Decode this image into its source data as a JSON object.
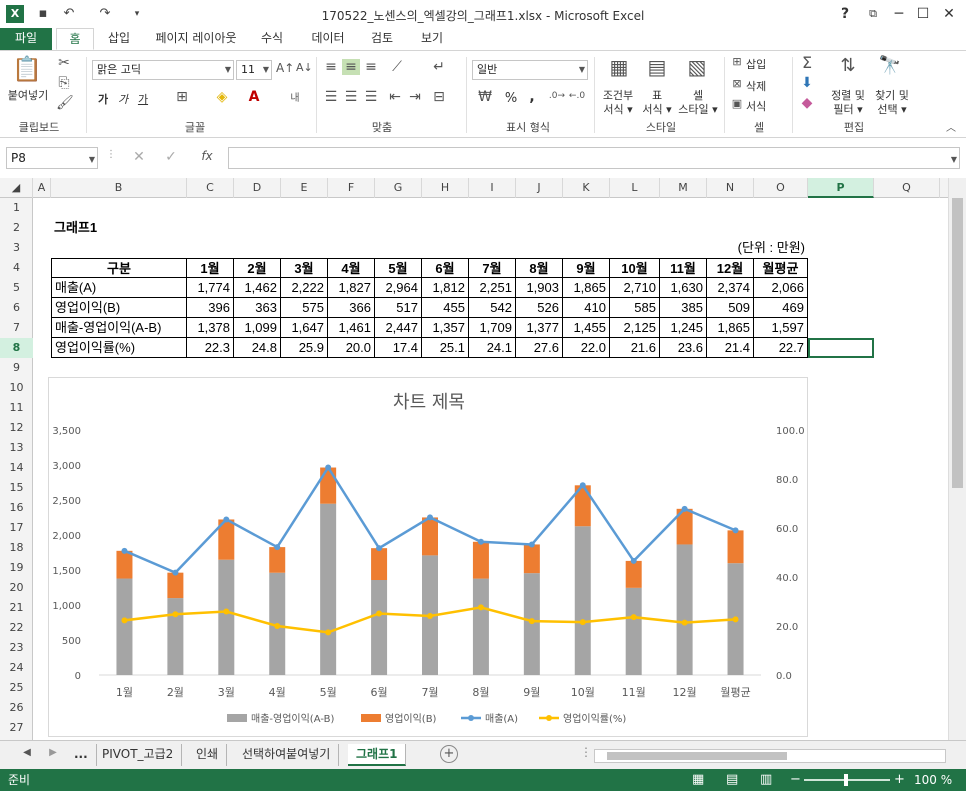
{
  "window": {
    "title": "170522_노센스의_엑셀강의_그래프1.xlsx - Microsoft Excel",
    "help": "?",
    "controls": [
      "─",
      "☐",
      "✕"
    ]
  },
  "tabs": [
    "파일",
    "홈",
    "삽입",
    "페이지 레이아웃",
    "수식",
    "데이터",
    "검토",
    "보기"
  ],
  "active_tab": "홈",
  "ribbon": {
    "clipboard": {
      "paste": "붙여넣기",
      "label": "클립보드"
    },
    "font": {
      "name": "맑은 고딕",
      "size": "11",
      "label": "글꼴",
      "bold": "가",
      "italic": "가",
      "underline": "가"
    },
    "align": {
      "label": "맞춤",
      "wrap": "내부"
    },
    "number": {
      "format": "일반",
      "label": "표시 형식",
      "pct": "%",
      "comma": ","
    },
    "styles": {
      "cond": "조건부\n서식",
      "cond1": "조건부",
      "cond2": "서식 ▾",
      "table1": "표",
      "table2": "서식 ▾",
      "cell1": "셀",
      "cell2": "스타일 ▾",
      "label": "스타일"
    },
    "cells": {
      "insert": "삽입",
      "delete": "삭제",
      "format": "서식",
      "label": "셀"
    },
    "edit": {
      "sort1": "정렬 및",
      "sort2": "필터 ▾",
      "find1": "찾기 및",
      "find2": "선택 ▾",
      "label": "편집"
    }
  },
  "formula_bar": {
    "name_box": "P8",
    "fx": "fx",
    "value": ""
  },
  "columns": [
    "A",
    "B",
    "C",
    "D",
    "E",
    "F",
    "G",
    "H",
    "I",
    "J",
    "K",
    "L",
    "M",
    "N",
    "O",
    "P",
    "Q"
  ],
  "selected_column": "P",
  "rows": [
    "1",
    "2",
    "3",
    "4",
    "5",
    "6",
    "7",
    "8",
    "9",
    "10",
    "11",
    "12",
    "13",
    "14",
    "15",
    "16",
    "17",
    "18",
    "19",
    "20",
    "21",
    "22",
    "23",
    "24",
    "25",
    "26",
    "27"
  ],
  "selected_row": "8",
  "sheet": {
    "title": "그래프1",
    "unit": "(단위 : 만원)",
    "header": [
      "구분",
      "1월",
      "2월",
      "3월",
      "4월",
      "5월",
      "6월",
      "7월",
      "8월",
      "9월",
      "10월",
      "11월",
      "12월",
      "월평균"
    ],
    "table": [
      [
        "매출(A)",
        "1,774",
        "1,462",
        "2,222",
        "1,827",
        "2,964",
        "1,812",
        "2,251",
        "1,903",
        "1,865",
        "2,710",
        "1,630",
        "2,374",
        "2,066"
      ],
      [
        "영업이익(B)",
        "396",
        "363",
        "575",
        "366",
        "517",
        "455",
        "542",
        "526",
        "410",
        "585",
        "385",
        "509",
        "469"
      ],
      [
        "매출-영업이익(A-B)",
        "1,378",
        "1,099",
        "1,647",
        "1,461",
        "2,447",
        "1,357",
        "1,709",
        "1,377",
        "1,455",
        "2,125",
        "1,245",
        "1,865",
        "1,597"
      ],
      [
        "영업이익률(%)",
        "22.3",
        "24.8",
        "25.9",
        "20.0",
        "17.4",
        "25.1",
        "24.1",
        "27.6",
        "22.0",
        "21.6",
        "23.6",
        "21.4",
        "22.7"
      ]
    ]
  },
  "chart_data": {
    "type": "bar",
    "title": "차트 제목",
    "categories": [
      "1월",
      "2월",
      "3월",
      "4월",
      "5월",
      "6월",
      "7월",
      "8월",
      "9월",
      "10월",
      "11월",
      "12월",
      "월평균"
    ],
    "series": [
      {
        "name": "매출-영업이익(A-B)",
        "kind": "stacked-bar",
        "axis": "left",
        "color": "#a5a5a5",
        "values": [
          1378,
          1099,
          1647,
          1461,
          2447,
          1357,
          1709,
          1377,
          1455,
          2125,
          1245,
          1865,
          1597
        ]
      },
      {
        "name": "영업이익(B)",
        "kind": "stacked-bar",
        "axis": "left",
        "color": "#ed7d31",
        "values": [
          396,
          363,
          575,
          366,
          517,
          455,
          542,
          526,
          410,
          585,
          385,
          509,
          469
        ]
      },
      {
        "name": "매출(A)",
        "kind": "line",
        "axis": "left",
        "color": "#5b9bd5",
        "values": [
          1774,
          1462,
          2222,
          1827,
          2964,
          1812,
          2251,
          1903,
          1865,
          2710,
          1630,
          2374,
          2066
        ]
      },
      {
        "name": "영업이익률(%)",
        "kind": "line",
        "axis": "right",
        "color": "#ffc000",
        "values": [
          22.3,
          24.8,
          25.9,
          20.0,
          17.4,
          25.1,
          24.1,
          27.6,
          22.0,
          21.6,
          23.6,
          21.4,
          22.7
        ]
      }
    ],
    "ylim": [
      0,
      3500
    ],
    "yticks": [
      "0",
      "500",
      "1,000",
      "1,500",
      "2,000",
      "2,500",
      "3,000",
      "3,500"
    ],
    "y2lim": [
      0,
      100
    ],
    "y2ticks": [
      "0.0",
      "20.0",
      "40.0",
      "60.0",
      "80.0",
      "100.0"
    ],
    "legend_position": "bottom",
    "grid": false
  },
  "sheet_tabs": {
    "nav_more": "...",
    "tabs": [
      "PIVOT_고급2",
      "인쇄",
      "선택하여붙여넣기",
      "그래프1"
    ],
    "active": "그래프1",
    "add": "+"
  },
  "status": {
    "text": "준비",
    "zoom": "100 %"
  }
}
